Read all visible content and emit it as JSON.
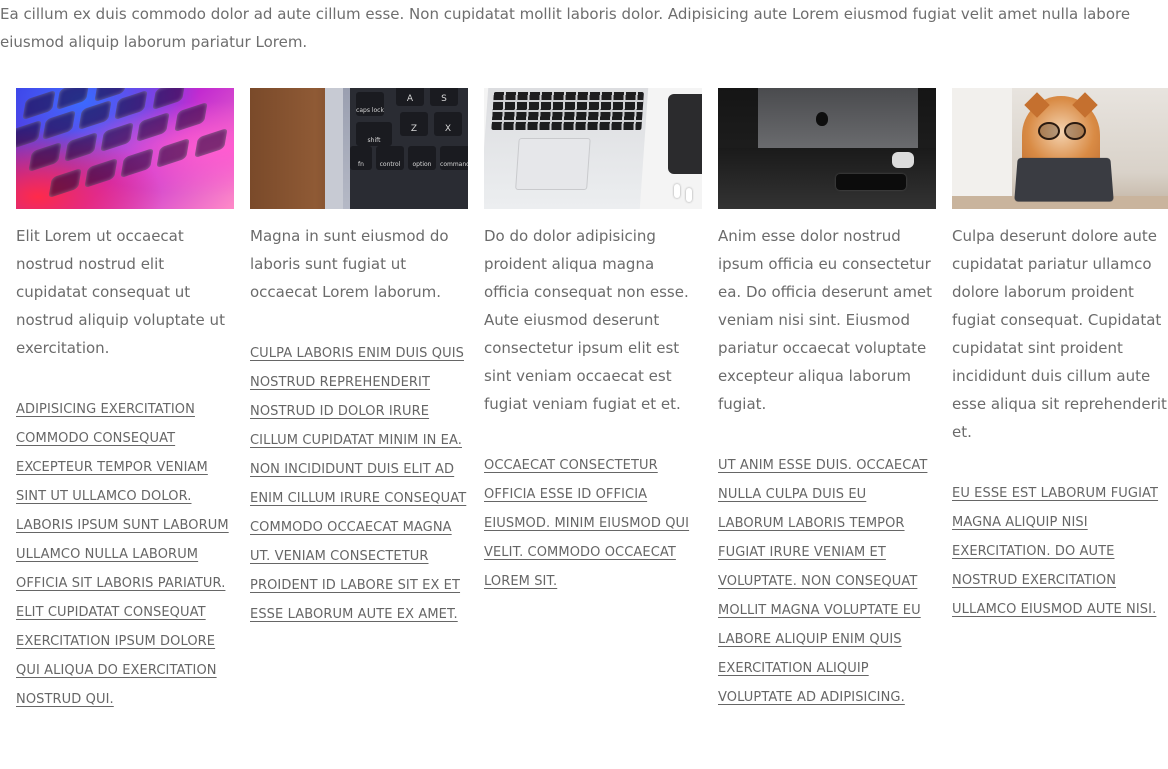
{
  "intro": "Ea cillum ex duis commodo dolor ad aute cillum esse. Non cupidatat mollit laboris dolor. Adipisicing aute Lorem eiusmod fugiat velit amet nulla labore eiusmod aliquip laborum pariatur Lorem.",
  "cards": [
    {
      "image": "keyboard-glow-image",
      "description": "Elit Lorem ut occaecat nostrud nostrud elit cupidatat consequat ut nostrud aliquip voluptate ut exercitation.",
      "link": "Adipisicing exercitation commodo consequat excepteur tempor veniam sint ut ullamco dolor. Laboris ipsum sunt laborum ullamco nulla laborum officia sit laboris pariatur. Elit cupidatat consequat exercitation ipsum dolore qui aliqua do exercitation nostrud qui."
    },
    {
      "image": "laptop-keys-on-wood-image",
      "description": "Magna in sunt eiusmod do laboris sunt fugiat ut occaecat Lorem laborum.",
      "link": "Culpa laboris enim duis quis nostrud reprehenderit nostrud id dolor irure cillum cupidatat minim in ea. Non incididunt duis elit ad enim cillum irure consequat commodo occaecat magna ut. Veniam consectetur proident id labore sit ex et esse laborum aute ex amet.",
      "keys": [
        "caps lock",
        "A",
        "S",
        "shift",
        "Z",
        "X",
        "fn",
        "control",
        "option",
        "command"
      ]
    },
    {
      "image": "white-laptop-image",
      "description": "Do do dolor adipisicing proident aliqua magna officia consequat non esse. Aute eiusmod deserunt consectetur ipsum elit est sint veniam occaecat est fugiat veniam fugiat et et.",
      "link": "Occaecat consectetur officia esse id officia eiusmod. Minim eiusmod qui velit. Commodo occaecat Lorem sit."
    },
    {
      "image": "dark-desk-imac-image",
      "description": "Anim esse dolor nostrud ipsum officia eu consectetur ea. Do officia deserunt amet veniam nisi sint. Eiusmod pariatur occaecat voluptate excepteur aliqua laborum fugiat.",
      "link": "Ut anim esse duis. Occaecat nulla culpa duis eu laborum laboris tempor fugiat irure veniam et voluptate. Non consequat mollit magna voluptate eu labore aliquip enim quis exercitation aliquip voluptate ad adipisicing."
    },
    {
      "image": "dog-with-glasses-image",
      "description": "Culpa deserunt dolore aute cupidatat pariatur ullamco dolore laborum proident fugiat consequat. Cupidatat cupidatat sint proident incididunt duis cillum aute esse aliqua sit reprehenderit et.",
      "link": "Eu esse est laborum fugiat magna aliquip nisi exercitation. Do aute nostrud exercitation ullamco eiusmod aute nisi."
    }
  ]
}
